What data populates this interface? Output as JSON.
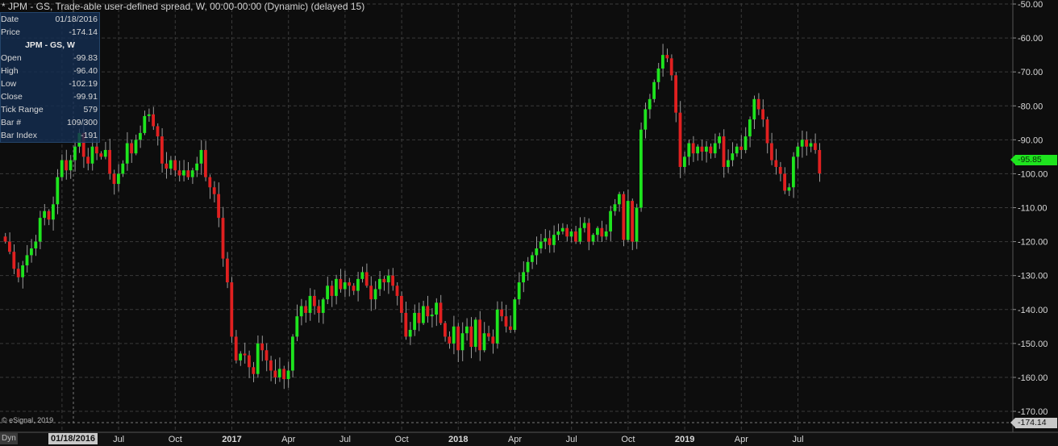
{
  "window": {
    "title": "* JPM - GS, Trade-able user-defined spread, W, 00:00-00:00 (Dynamic) (delayed 15)"
  },
  "info_panel": {
    "top_rows": [
      {
        "label": "Date",
        "value": "01/18/2016"
      },
      {
        "label": "Price",
        "value": "-174.14"
      }
    ],
    "header": "JPM - GS, W",
    "rows": [
      {
        "label": "Open",
        "value": "-99.83"
      },
      {
        "label": "High",
        "value": "-96.40"
      },
      {
        "label": "Low",
        "value": "-102.19"
      },
      {
        "label": "Close",
        "value": "-99.91"
      },
      {
        "label": "Tick Range",
        "value": "579"
      },
      {
        "label": "Bar #",
        "value": "109/300"
      },
      {
        "label": "Bar Index",
        "value": "-191"
      }
    ]
  },
  "last_price_tag": "-95.85",
  "cursor_price_tag": "-174.14",
  "cursor_date_tag": "01/18/2016",
  "dyn_label": "Dyn",
  "copyright": "© eSignal, 2019",
  "colors": {
    "background": "#0d0d0d",
    "up": "#1ee41e",
    "down": "#e02020",
    "grid": "#3a3a3a",
    "axis_text": "#d8d8d8"
  },
  "chart_data": {
    "type": "candlestick",
    "title": "* JPM - GS, Trade-able user-defined spread, W, 00:00-00:00 (Dynamic) (delayed 15)",
    "y_ticks": [
      -50,
      -60,
      -70,
      -80,
      -90,
      -100,
      -110,
      -120,
      -130,
      -140,
      -150,
      -160,
      -170
    ],
    "y_tick_labels": [
      "-50.00",
      "-60.00",
      "-70.00",
      "-80.00",
      "-90.00",
      "-100.00",
      "-110.00",
      "-120.00",
      "-130.00",
      "-140.00",
      "-150.00",
      "-160.00",
      "-170.00"
    ],
    "ylim": [
      -175,
      -49
    ],
    "x_ticks": [
      "Apr",
      "Jul",
      "Oct",
      "2017",
      "Apr",
      "Jul",
      "Oct",
      "2018",
      "Apr",
      "Jul",
      "Oct",
      "2019",
      "Apr",
      "Jul"
    ],
    "x_tick_bars": [
      13,
      26,
      39,
      52,
      65,
      78,
      91,
      104,
      117,
      130,
      143,
      156,
      169,
      182
    ],
    "bar_count": 192,
    "grid": true,
    "closes": [
      -120.0,
      -123.0,
      -128.0,
      -130.5,
      -127.0,
      -124.0,
      -122.0,
      -120.0,
      -113.0,
      -111.0,
      -113.5,
      -109.0,
      -101.0,
      -96.0,
      -99.0,
      -96.0,
      -92.0,
      -88.0,
      -95.0,
      -97.0,
      -92.0,
      -94.0,
      -95.0,
      -93.0,
      -100.0,
      -103.0,
      -100.0,
      -97.0,
      -91.0,
      -94.0,
      -90.0,
      -88.0,
      -83.0,
      -82.5,
      -86.0,
      -89.0,
      -97.0,
      -98.5,
      -96.0,
      -99.0,
      -100.5,
      -99.0,
      -101.0,
      -99.0,
      -97.0,
      -93.0,
      -101.0,
      -104.0,
      -106.0,
      -113.0,
      -125.0,
      -132.0,
      -148.0,
      -155.0,
      -153.0,
      -153.5,
      -157.0,
      -159.0,
      -150.0,
      -152.0,
      -155.0,
      -158.0,
      -160.0,
      -157.5,
      -160.5,
      -158.0,
      -148.0,
      -142.0,
      -139.0,
      -141.0,
      -136.0,
      -139.0,
      -141.0,
      -137.0,
      -133.0,
      -136.0,
      -131.0,
      -134.0,
      -132.0,
      -133.0,
      -134.5,
      -131.0,
      -129.0,
      -133.0,
      -137.0,
      -134.0,
      -131.0,
      -132.0,
      -130.0,
      -133.0,
      -136.0,
      -141.0,
      -148.0,
      -146.0,
      -141.0,
      -144.0,
      -139.0,
      -142.0,
      -141.5,
      -138.0,
      -144.0,
      -148.0,
      -150.0,
      -145.0,
      -152.0,
      -147.0,
      -145.0,
      -151.0,
      -143.0,
      -152.0,
      -147.0,
      -148.0,
      -150.0,
      -140.0,
      -142.0,
      -145.0,
      -146.0,
      -137.0,
      -132.0,
      -129.0,
      -126.0,
      -124.0,
      -122.0,
      -120.0,
      -119.0,
      -121.0,
      -118.0,
      -117.0,
      -116.0,
      -118.5,
      -117.0,
      -120.0,
      -116.0,
      -114.5,
      -120.0,
      -118.0,
      -116.0,
      -118.5,
      -117.0,
      -111.0,
      -109.0,
      -106.0,
      -119.5,
      -108.0,
      -120.0,
      -110.0,
      -87.0,
      -81.0,
      -78.0,
      -73.0,
      -69.0,
      -65.0,
      -66.0,
      -71.0,
      -82.0,
      -98.0,
      -95.0,
      -91.0,
      -94.0,
      -92.0,
      -93.5,
      -92.0,
      -94.0,
      -91.0,
      -89.0,
      -98.0,
      -96.0,
      -94.0,
      -92.0,
      -93.0,
      -89.0,
      -84.0,
      -78.0,
      -81.0,
      -84.0,
      -91.0,
      -96.0,
      -98.0,
      -100.0,
      -105.0,
      -104.0,
      -95.0,
      -92.0,
      -90.0,
      -92.0,
      -91.0,
      -93.0,
      -99.91
    ],
    "last_close": -95.85
  }
}
